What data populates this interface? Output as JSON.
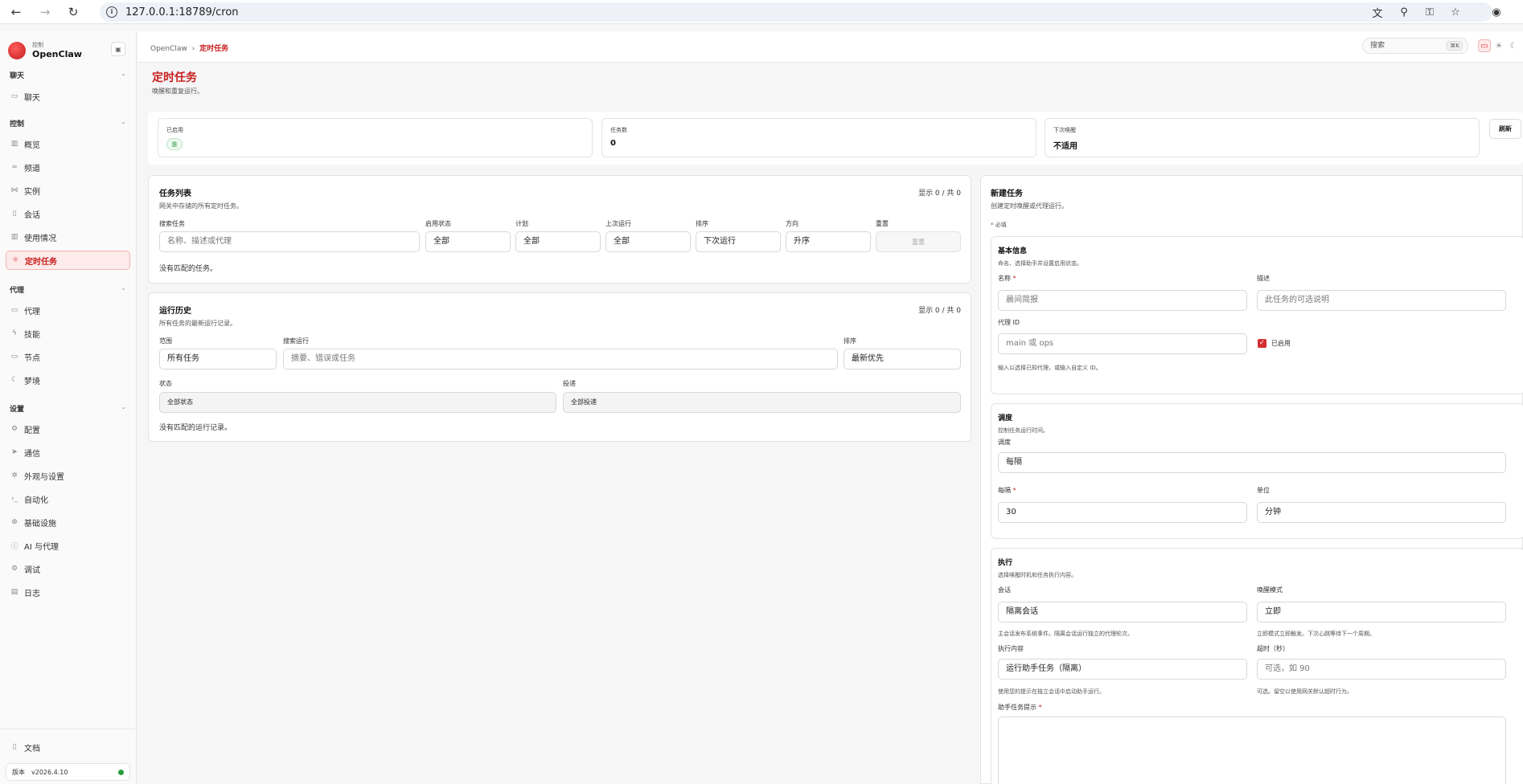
{
  "browser": {
    "url": "127.0.0.1:18789/cron"
  },
  "sidebar": {
    "brand_sub": "控制",
    "brand_name": "OpenClaw",
    "sections": {
      "chat": "聊天",
      "control": "控制",
      "agent": "代理",
      "settings": "设置"
    },
    "items": {
      "chat": "聊天",
      "overview": "概览",
      "channels": "频道",
      "instances": "实例",
      "sessions": "会话",
      "usage": "使用情况",
      "cron": "定时任务",
      "agents": "代理",
      "skills": "技能",
      "nodes": "节点",
      "dreams": "梦境",
      "config": "配置",
      "comms": "通信",
      "appearance": "外观与设置",
      "automation": "自动化",
      "infra": "基础设施",
      "ai_agents": "AI 与代理",
      "debug": "调试",
      "logs": "日志",
      "docs": "文档"
    },
    "version_label": "版本",
    "version": "v2026.4.10"
  },
  "topbar": {
    "crumb_root": "OpenClaw",
    "crumb_sep": "›",
    "crumb_current": "定时任务",
    "search_placeholder": "搜索",
    "search_kbd": "⌘K"
  },
  "page": {
    "title": "定时任务",
    "subtitle": "唤醒和重复运行。"
  },
  "stats": {
    "enabled_label": "已启用",
    "enabled_value": "是",
    "tasks_label": "任务数",
    "tasks_value": "0",
    "next_wake_label": "下次唤醒",
    "next_wake_value": "不适用",
    "refresh": "刷新"
  },
  "task_list": {
    "title": "任务列表",
    "desc": "网关中存储的所有定时任务。",
    "count": "显示 0 / 共 0",
    "search_label": "搜索任务",
    "search_placeholder": "名称、描述或代理",
    "enabled_label": "启用状态",
    "enabled_value": "全部",
    "schedule_label": "计划",
    "schedule_value": "全部",
    "last_run_label": "上次运行",
    "last_run_value": "全部",
    "sort_label": "排序",
    "sort_value": "下次运行",
    "dir_label": "方向",
    "dir_value": "升序",
    "reset_label": "重置",
    "reset_button": "重置",
    "empty": "没有匹配的任务。"
  },
  "run_history": {
    "title": "运行历史",
    "desc": "所有任务的最新运行记录。",
    "count": "显示 0 / 共 0",
    "scope_label": "范围",
    "scope_value": "所有任务",
    "search_label": "搜索运行",
    "search_placeholder": "摘要、错误或任务",
    "sort_label": "排序",
    "sort_value": "最新优先",
    "status_label": "状态",
    "status_value": "全部状态",
    "delivery_label": "投递",
    "delivery_value": "全部投递",
    "empty": "没有匹配的运行记录。"
  },
  "new_task": {
    "title": "新建任务",
    "desc": "创建定时唤醒或代理运行。",
    "required_note": "* 必填",
    "basic": {
      "title": "基本信息",
      "desc": "命名、选择助手并设置启用状态。",
      "name_label": "名称",
      "name_placeholder": "晨间简报",
      "desc_label": "描述",
      "desc_placeholder": "此任务的可选说明",
      "agent_label": "代理 ID",
      "agent_placeholder": "main 或 ops",
      "enabled_label": "已启用",
      "agent_hint": "输入以选择已知代理，或输入自定义 ID。"
    },
    "schedule": {
      "title": "调度",
      "desc": "控制任务运行时间。",
      "kind_label": "调度",
      "kind_value": "每隔",
      "every_label": "每隔",
      "every_value": "30",
      "unit_label": "单位",
      "unit_value": "分钟"
    },
    "execution": {
      "title": "执行",
      "desc": "选择唤醒时机和任务执行内容。",
      "session_label": "会话",
      "session_value": "隔离会话",
      "session_hint": "主会话发布系统事件。隔离会话运行独立的代理轮次。",
      "wake_label": "唤醒模式",
      "wake_value": "立即",
      "wake_hint": "立即模式立即触发。下次心跳等待下一个周期。",
      "payload_label": "执行内容",
      "payload_value": "运行助手任务（隔离）",
      "payload_hint": "使用您的提示在独立会话中启动助手运行。",
      "timeout_label": "超时（秒）",
      "timeout_placeholder": "可选，如 90",
      "timeout_hint": "可选。留空以使用网关默认超时行为。",
      "prompt_label": "助手任务提示"
    }
  },
  "colors": {
    "accent": "#c81e1e",
    "status_ok": "#2a9d3a"
  }
}
